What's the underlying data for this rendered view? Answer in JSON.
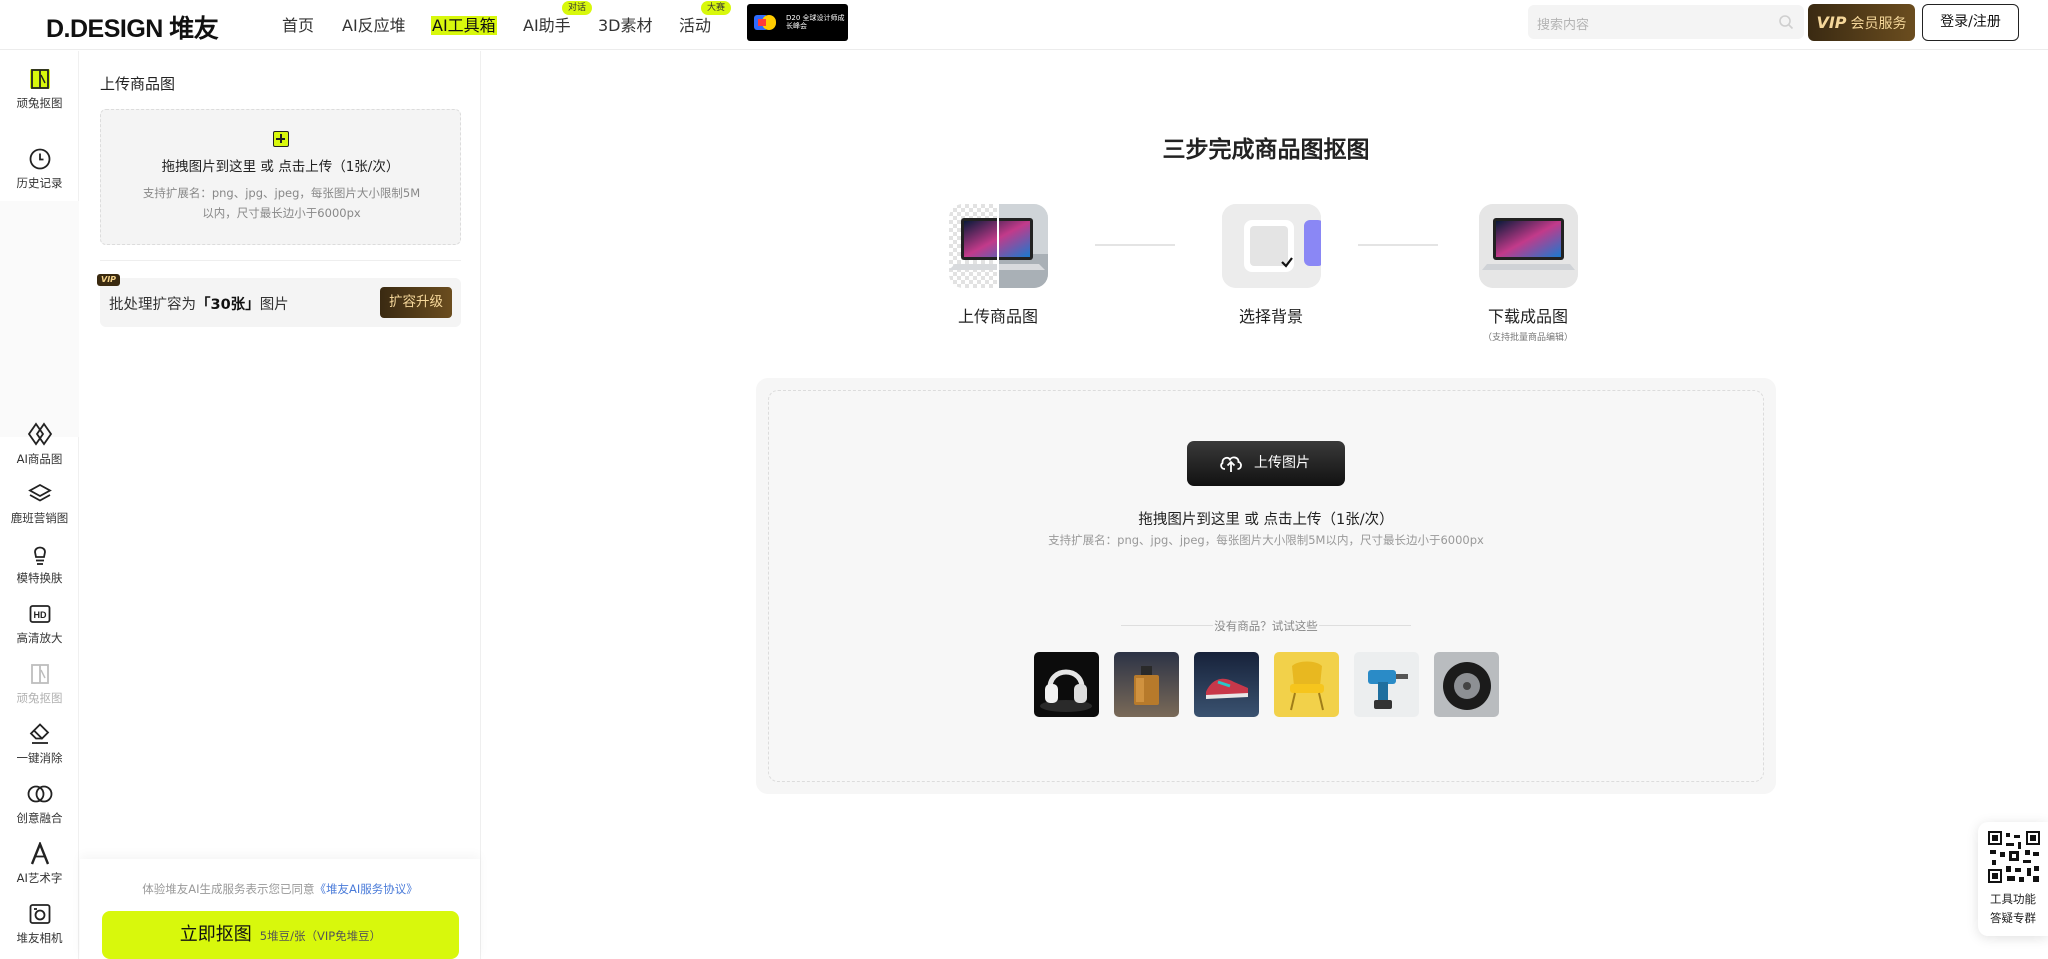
{
  "header": {
    "logo_text": "D.DESIGN 堆友",
    "nav": [
      {
        "label": "首页",
        "badge": ""
      },
      {
        "label": "AI反应堆",
        "badge": ""
      },
      {
        "label": "AI工具箱",
        "badge": "",
        "active": true
      },
      {
        "label": "AI助手",
        "badge": "对话"
      },
      {
        "label": "3D素材",
        "badge": ""
      },
      {
        "label": "活动",
        "badge": "大赛"
      }
    ],
    "promo_text": "D20 全球设计师成长峰会",
    "search_placeholder": "搜索内容",
    "vip_logo": "VIP",
    "vip_label": "会员服务",
    "login_label": "登录/注册"
  },
  "rail": {
    "items": [
      {
        "label": "顽兔抠图",
        "icon": "cutout-icon"
      },
      {
        "label": "历史记录",
        "icon": "clock-icon"
      },
      {
        "label": "AI商品图",
        "icon": "ai-product-icon"
      },
      {
        "label": "鹿班营销图",
        "icon": "layers-icon"
      },
      {
        "label": "模特换肤",
        "icon": "model-icon"
      },
      {
        "label": "高清放大",
        "icon": "hd-icon"
      },
      {
        "label": "顽兔抠图",
        "icon": "cutout-icon"
      },
      {
        "label": "一键消除",
        "icon": "eraser-icon"
      },
      {
        "label": "创意融合",
        "icon": "fusion-icon"
      },
      {
        "label": "AI艺术字",
        "icon": "art-text-icon"
      },
      {
        "label": "堆友相机",
        "icon": "camera-icon"
      }
    ]
  },
  "panel": {
    "title": "上传商品图",
    "drop_main": "拖拽图片到这里 或 点击上传（1张/次）",
    "drop_hint_1": "支持扩展名：png、jpg、jpeg，每张图片大小限制5M",
    "drop_hint_2": "以内，尺寸最长边小于6000px",
    "vip_tag": "VIP",
    "batch_prefix": "批处理扩容为",
    "batch_count": "「30张」",
    "batch_suffix": "图片",
    "upgrade_label": "扩容升级",
    "agree_prefix": "体验堆友AI生成服务表示您已同意",
    "agree_link": "《堆友AI服务协议》",
    "cta_label": "立即抠图",
    "cta_cost": "5堆豆/张（VIP免堆豆）"
  },
  "main": {
    "title": "三步完成商品图抠图",
    "steps": [
      {
        "label": "上传商品图",
        "sub": ""
      },
      {
        "label": "选择背景",
        "sub": ""
      },
      {
        "label": "下载成品图",
        "sub": "（支持批量商品编辑）"
      }
    ],
    "upload_button": "上传图片",
    "upload_main": "拖拽图片到这里 或 点击上传（1张/次）",
    "upload_hint": "支持扩展名：png、jpg、jpeg，每张图片大小限制5M以内，尺寸最长边小于6000px",
    "try_label": "没有商品？试试这些",
    "samples": [
      "headphones",
      "perfume",
      "sneaker",
      "yellow-chair",
      "power-drill",
      "tire"
    ]
  },
  "float_widget": {
    "line1": "工具功能",
    "line2": "答疑专群"
  },
  "colors": {
    "accent": "#d8f80c",
    "vip_dark": "#3a2a12",
    "vip_gold": "#f5d79a",
    "link": "#4a7bd9"
  }
}
